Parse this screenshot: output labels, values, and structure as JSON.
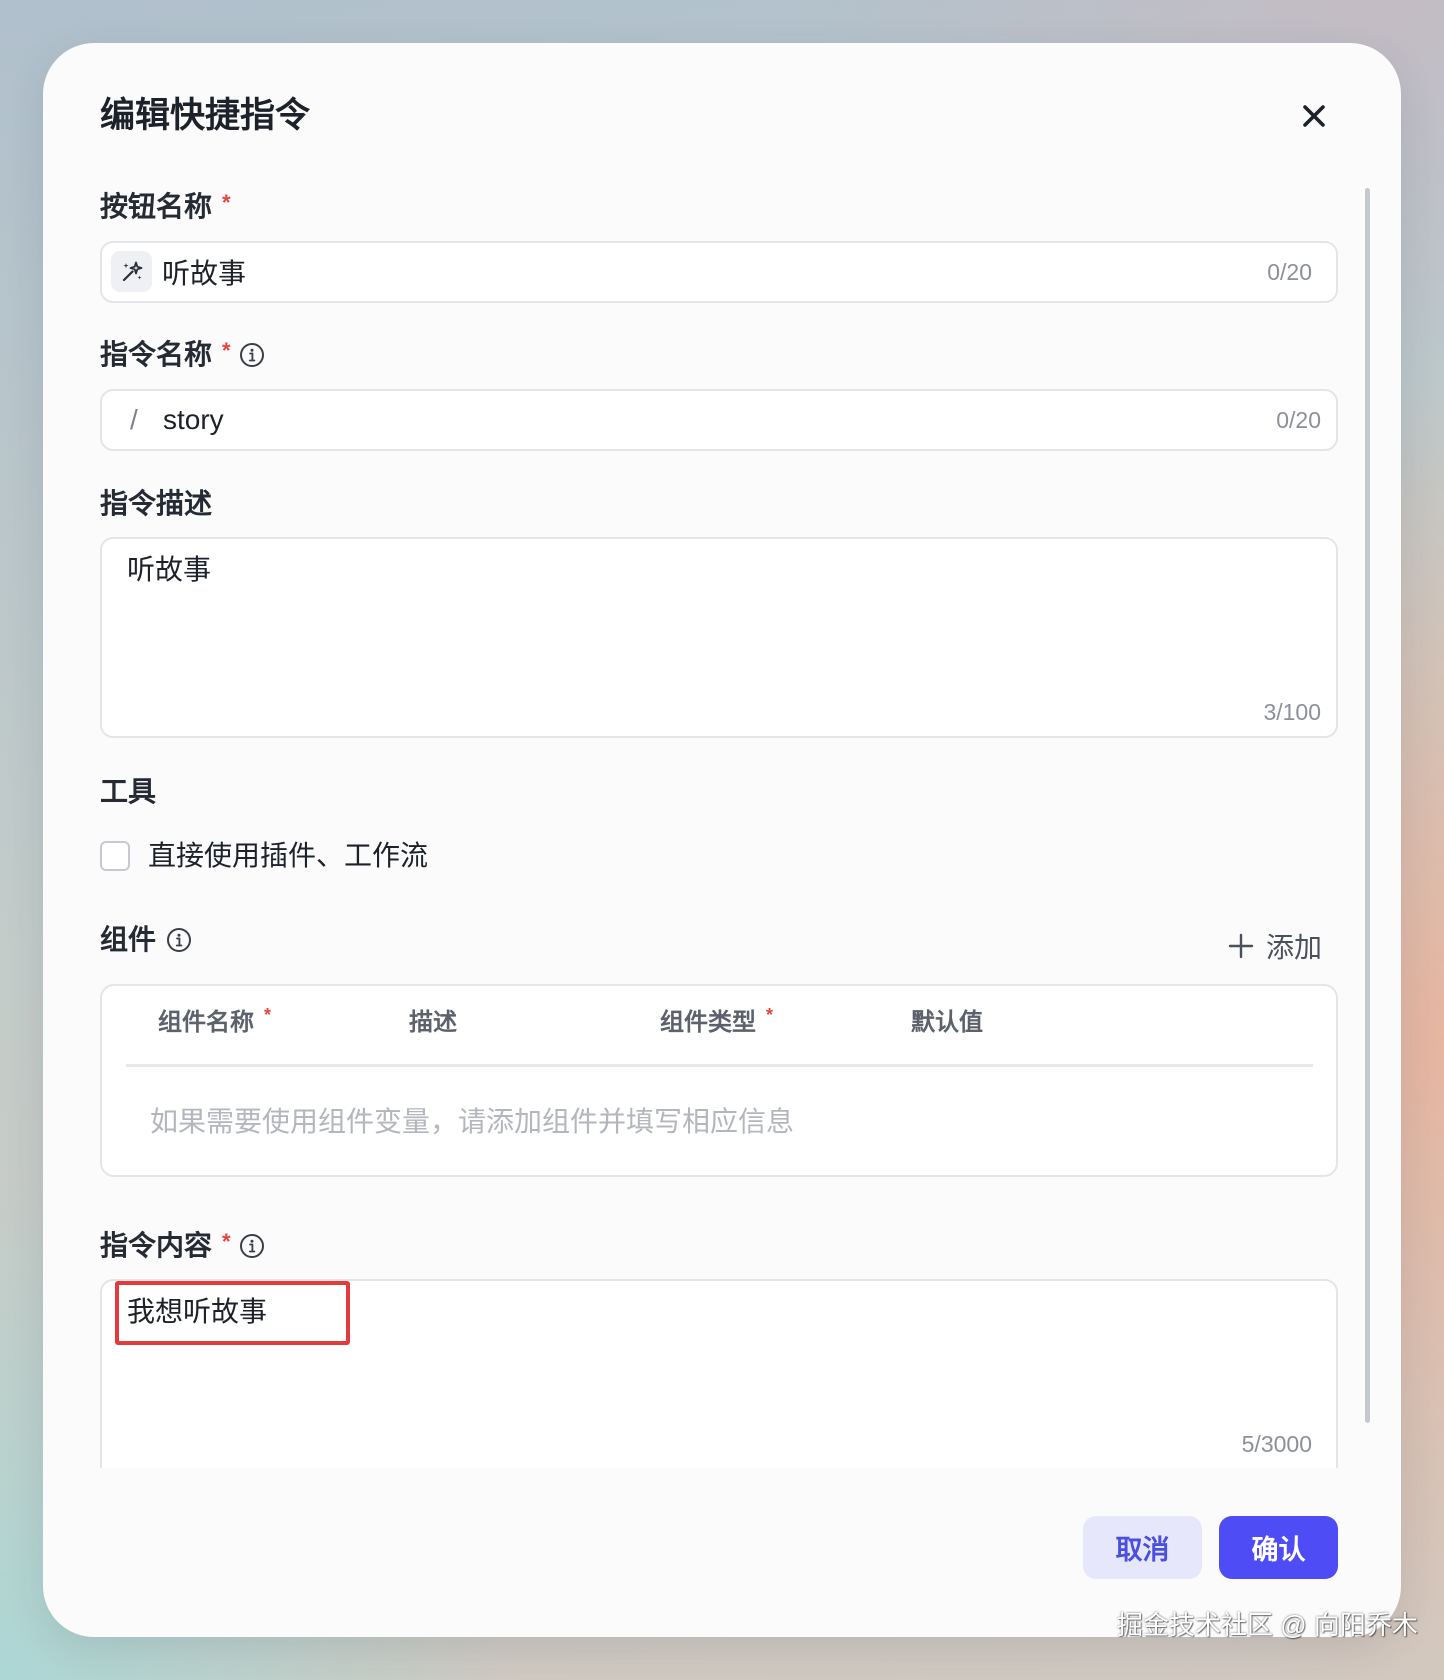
{
  "dialog": {
    "title": "编辑快捷指令",
    "close_icon": "close-icon"
  },
  "button_name": {
    "label": "按钮名称",
    "required_mark": "*",
    "icon": "magic-wand-icon",
    "value": "听故事",
    "counter": "0/20"
  },
  "command_name": {
    "label": "指令名称",
    "required_mark": "*",
    "info_icon": "info-icon",
    "prefix": "/",
    "value": "story",
    "counter": "0/20"
  },
  "command_description": {
    "label": "指令描述",
    "value": "听故事",
    "counter": "3/100"
  },
  "tools": {
    "label": "工具",
    "checkbox_label": "直接使用插件、工作流",
    "checked": false
  },
  "components": {
    "label": "组件",
    "info_icon": "info-icon",
    "add_icon": "plus-icon",
    "add_label": "添加",
    "columns": [
      {
        "label": "组件名称",
        "required_mark": "*"
      },
      {
        "label": "描述",
        "required_mark": ""
      },
      {
        "label": "组件类型",
        "required_mark": "*"
      },
      {
        "label": "默认值",
        "required_mark": ""
      }
    ],
    "empty_text": "如果需要使用组件变量，请添加组件并填写相应信息"
  },
  "command_content": {
    "label": "指令内容",
    "required_mark": "*",
    "info_icon": "info-icon",
    "value": "我想听故事",
    "counter": "5/3000"
  },
  "footer": {
    "cancel_label": "取消",
    "confirm_label": "确认"
  },
  "watermark": "掘金技术社区 @ 向阳乔木",
  "colors": {
    "accent": "#4e4cf5",
    "cancel_background": "#e6e7fb",
    "required": "#e5453a",
    "annotation_box": "#e23b3e"
  }
}
